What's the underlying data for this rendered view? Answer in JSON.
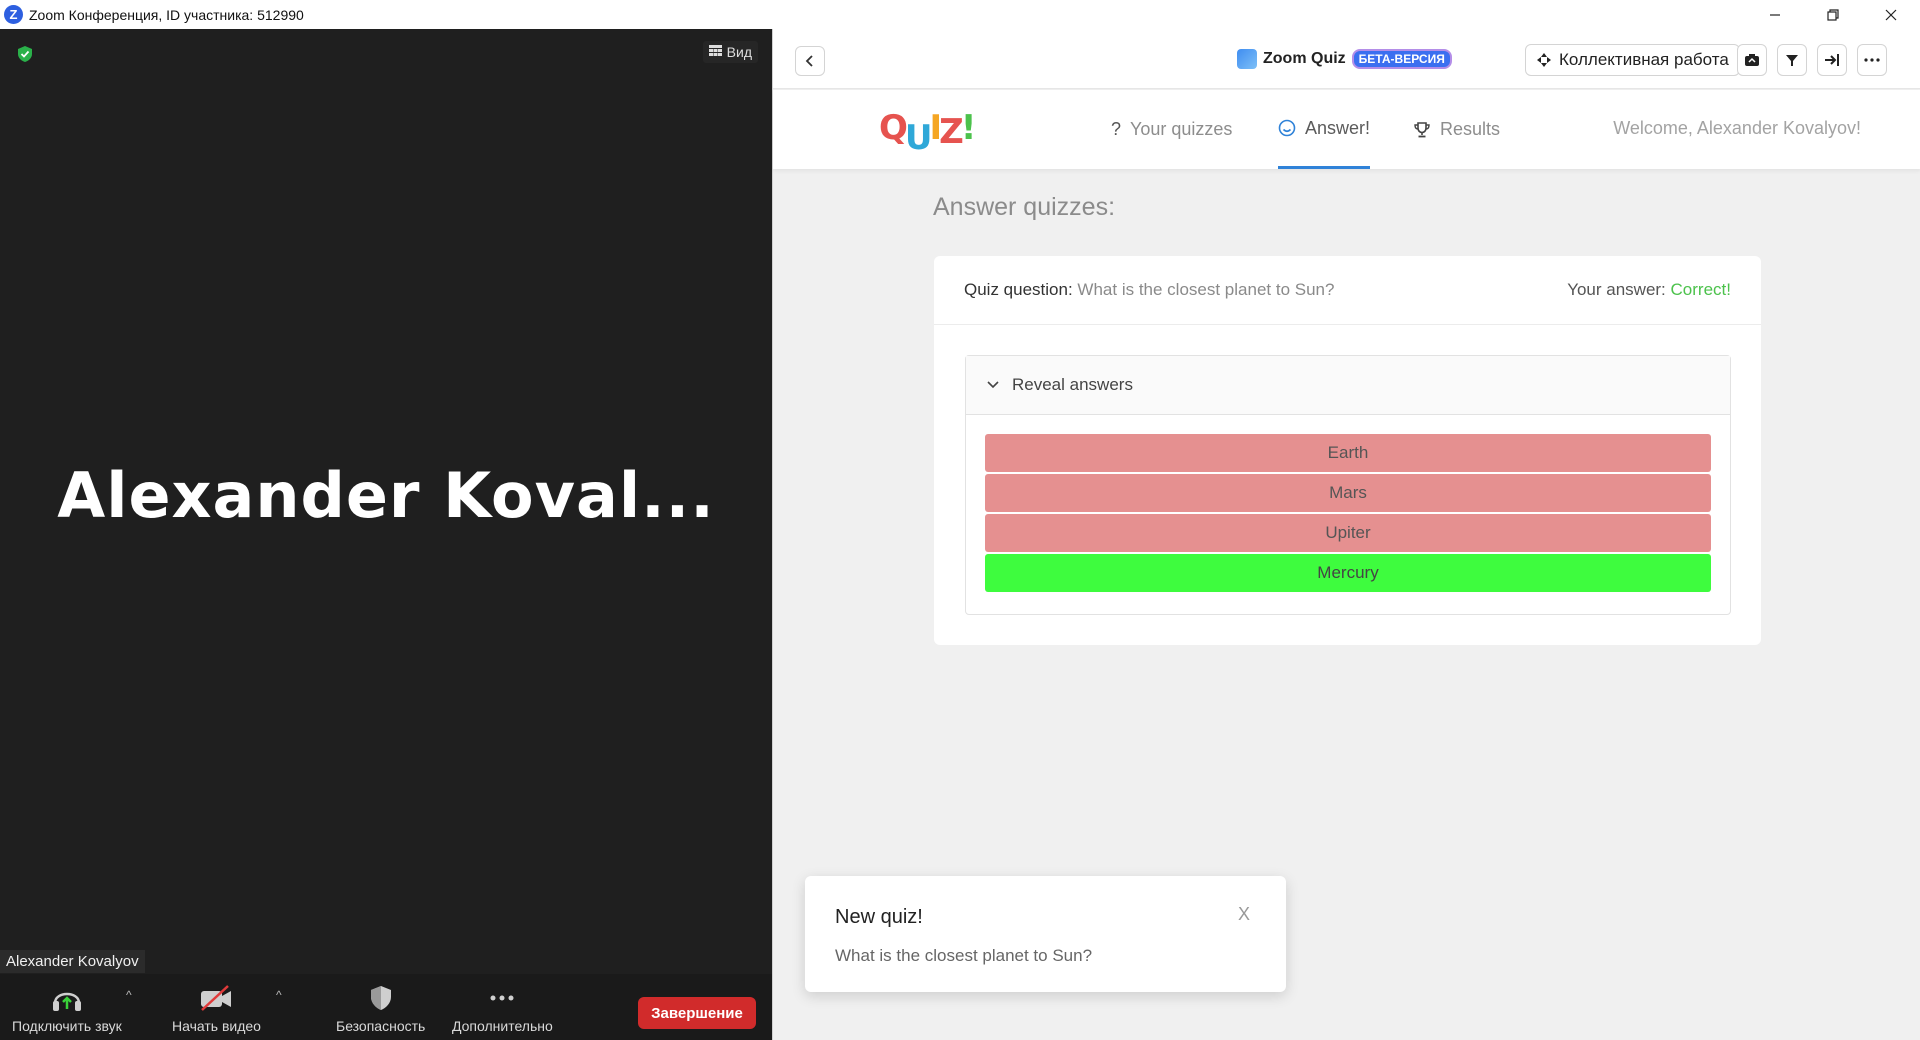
{
  "window": {
    "title": "Zoom Конференция, ID участника: 512990",
    "logo_letter": "Z",
    "controls": [
      "minimize-icon",
      "restore-icon",
      "close-icon"
    ]
  },
  "meeting": {
    "view_label": "Вид",
    "participant_big_name": "Alexander  Koval...",
    "participant_label": "Alexander Kovalyov",
    "toolbar": {
      "audio_label": "Подключить звук",
      "video_label": "Начать видео",
      "security_label": "Безопасность",
      "more_label": "Дополнительно",
      "end_label": "Завершение"
    }
  },
  "app": {
    "title": "Zoom Quiz",
    "beta_badge": "БЕТА-ВЕРСИЯ",
    "collab_label": "Коллективная работа",
    "logo": [
      "Q",
      "U",
      "I",
      "Z",
      "!"
    ],
    "logo_colors": [
      "#e6534f",
      "#2fa8d8",
      "#f5a623",
      "#e6534f",
      "#4cc24c"
    ],
    "nav": {
      "your_quizzes": "Your quizzes",
      "answer": "Answer!",
      "results": "Results"
    },
    "welcome": "Welcome, Alexander Kovalyov!",
    "page_heading": "Answer quizzes:",
    "quiz": {
      "question_label": "Quiz question:",
      "question_text": "What is the closest planet to Sun?",
      "answer_label": "Your answer:",
      "answer_status": "Correct!",
      "reveal_label": "Reveal answers",
      "answers": [
        {
          "text": "Earth",
          "correct": false
        },
        {
          "text": "Mars",
          "correct": false
        },
        {
          "text": "Upiter",
          "correct": false
        },
        {
          "text": "Mercury",
          "correct": true
        }
      ]
    },
    "notification": {
      "title": "New quiz!",
      "body": "What is the closest planet to Sun?",
      "close": "X"
    }
  },
  "colors": {
    "meeting_bg": "#1f1f1f",
    "end_button": "#d12b2b",
    "wrong_answer": "#e59090",
    "right_answer": "#3efc3e",
    "correct_text": "#4cc24c",
    "active_tab": "#2f82d8"
  }
}
